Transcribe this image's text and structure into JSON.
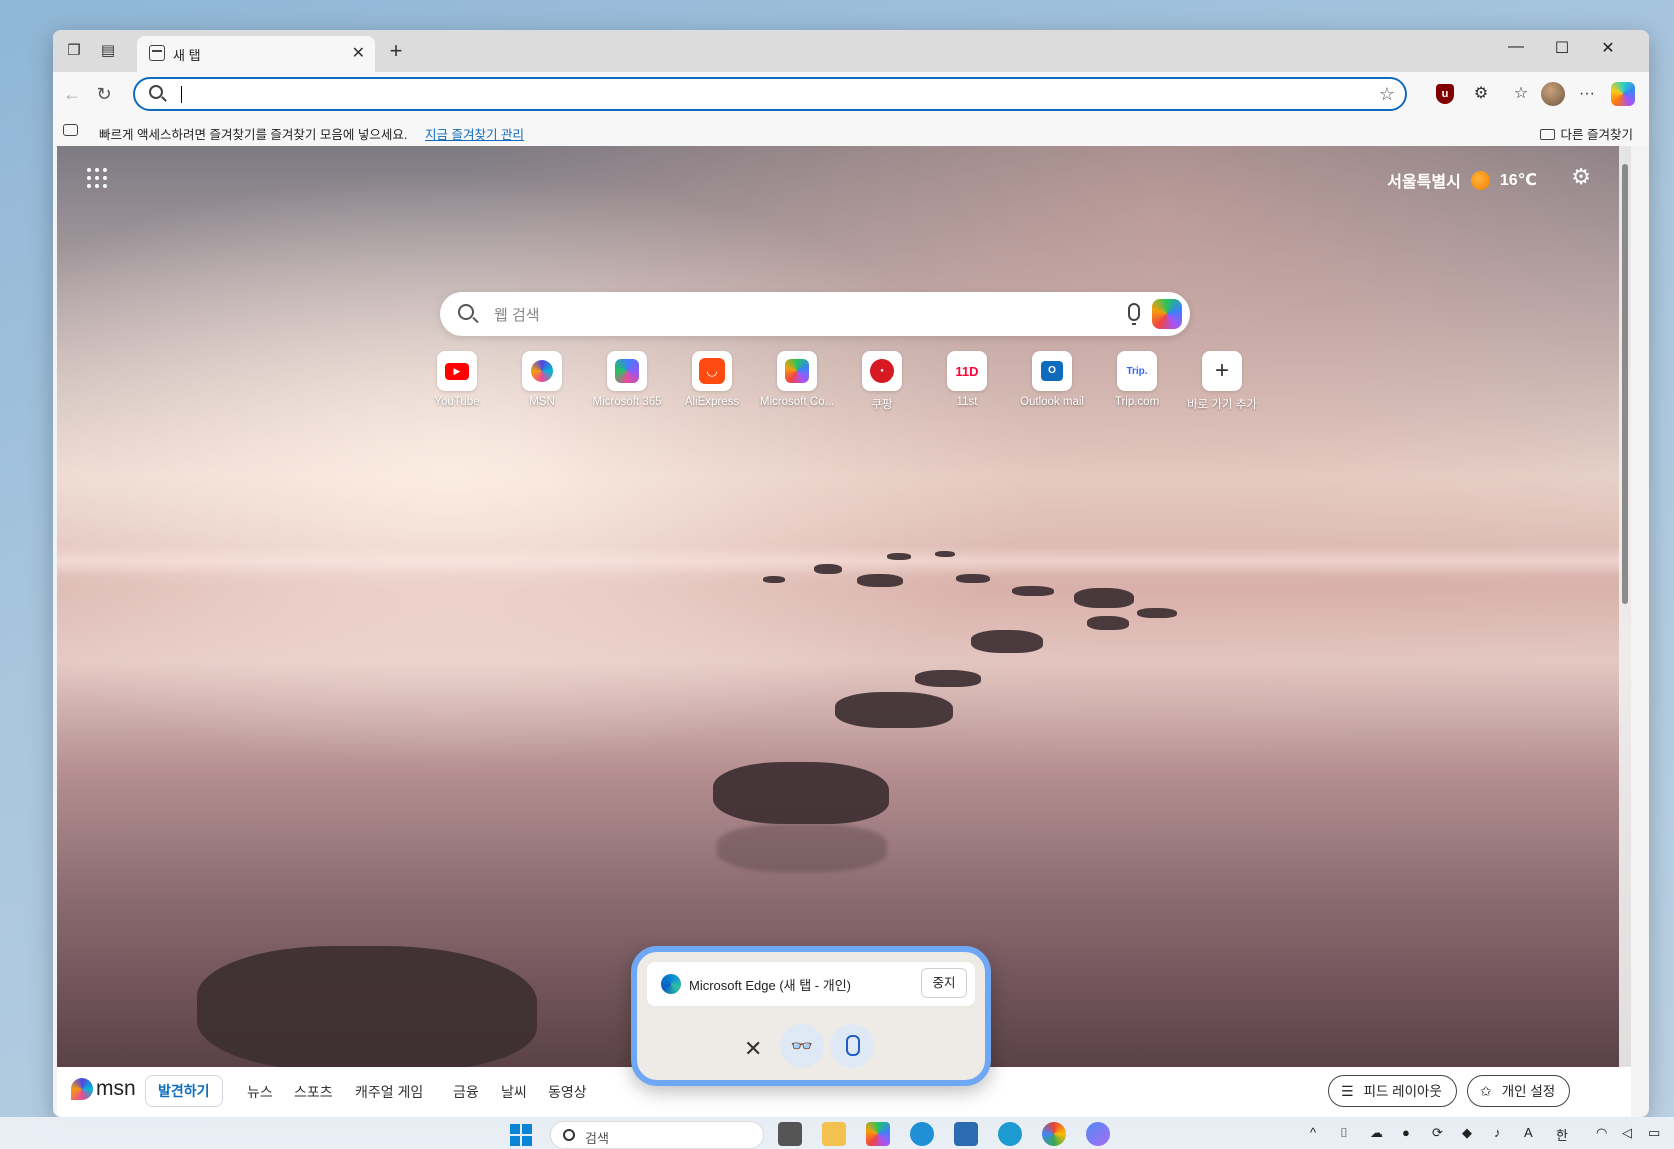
{
  "browser": {
    "tab": {
      "title": "새 탭",
      "close": "✕"
    },
    "newtab": "+",
    "window_controls": {
      "minimize": "—",
      "maximize": "☐",
      "close": "✕"
    },
    "nav": {
      "back": "←",
      "refresh": "↻"
    },
    "address": {
      "value": "",
      "star": "☆"
    },
    "extensions": {
      "ublock": "u",
      "puzzle": "⚙",
      "favorites": "☆",
      "more": "···"
    }
  },
  "favbar": {
    "message": "빠르게 액세스하려면 즐겨찾기를 즐겨찾기 모음에 넣으세요.",
    "link": "지금 즐겨찾기 관리",
    "other": "다른 즐겨찾기"
  },
  "ntp": {
    "weather": {
      "city": "서울특별시",
      "temp": "16℃"
    },
    "settings": "⚙",
    "search": {
      "placeholder": "웹 검색"
    },
    "quicklinks": [
      {
        "label": "YouTube",
        "icon": "youtube-icon"
      },
      {
        "label": "MSN",
        "icon": "msn-icon"
      },
      {
        "label": "Microsoft 365",
        "icon": "microsoft365-icon"
      },
      {
        "label": "AliExpress",
        "icon": "aliexpress-icon"
      },
      {
        "label": "Microsoft Co...",
        "icon": "copilot-icon"
      },
      {
        "label": "쿠팡",
        "icon": "coupang-icon"
      },
      {
        "label": "11st",
        "icon": "11st-icon",
        "glyph": "11D"
      },
      {
        "label": "Outlook mail",
        "icon": "outlook-icon",
        "glyph": "O"
      },
      {
        "label": "Trip.com",
        "icon": "trip-icon",
        "glyph": "Trip."
      },
      {
        "label": "바로 가기 추가",
        "icon": "plus-icon",
        "glyph": "+"
      }
    ]
  },
  "msn": {
    "logo": "msn",
    "discover": "발견하기",
    "nav": [
      "뉴스",
      "스포츠",
      "캐주얼 게임",
      "금융",
      "날씨",
      "동영상"
    ],
    "feed_layout": "피드 레이아웃",
    "personalize": "개인 설정"
  },
  "voice_popup": {
    "title": "Microsoft Edge (새 탭 - 개인)",
    "stop": "중지",
    "close": "✕",
    "glasses": "👓"
  },
  "taskbar": {
    "search_placeholder": "검색",
    "tray": {
      "chevron": "^",
      "ime_a": "A",
      "ime_han": "한"
    }
  },
  "colors": {
    "accent": "#0f6cbd",
    "popup_border": "#6ea8f4",
    "youtube": "#ff0000",
    "aliexpress": "#ff4a12"
  }
}
